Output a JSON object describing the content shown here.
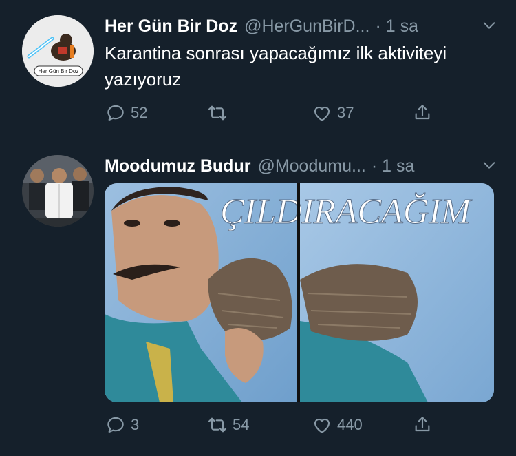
{
  "tweets": [
    {
      "name": "Her Gün Bir Doz",
      "handle": "@HerGunBirD...",
      "time": "· 1 sa",
      "text": "Karantina sonrası yapacağımız ilk aktiviteyi yazıyoruz",
      "avatar_label": "Her Gün Bir Doz",
      "reply_count": "52",
      "retweet_count": "",
      "like_count": "37"
    },
    {
      "name": "Moodumuz Budur",
      "handle": "@Moodumu...",
      "time": "· 1 sa",
      "media_caption": "ÇILDIRACAĞIM",
      "reply_count": "3",
      "retweet_count": "54",
      "like_count": "440"
    }
  ],
  "colors": {
    "background": "#15202b",
    "secondary_text": "#8899a6",
    "divider": "#38444d"
  }
}
